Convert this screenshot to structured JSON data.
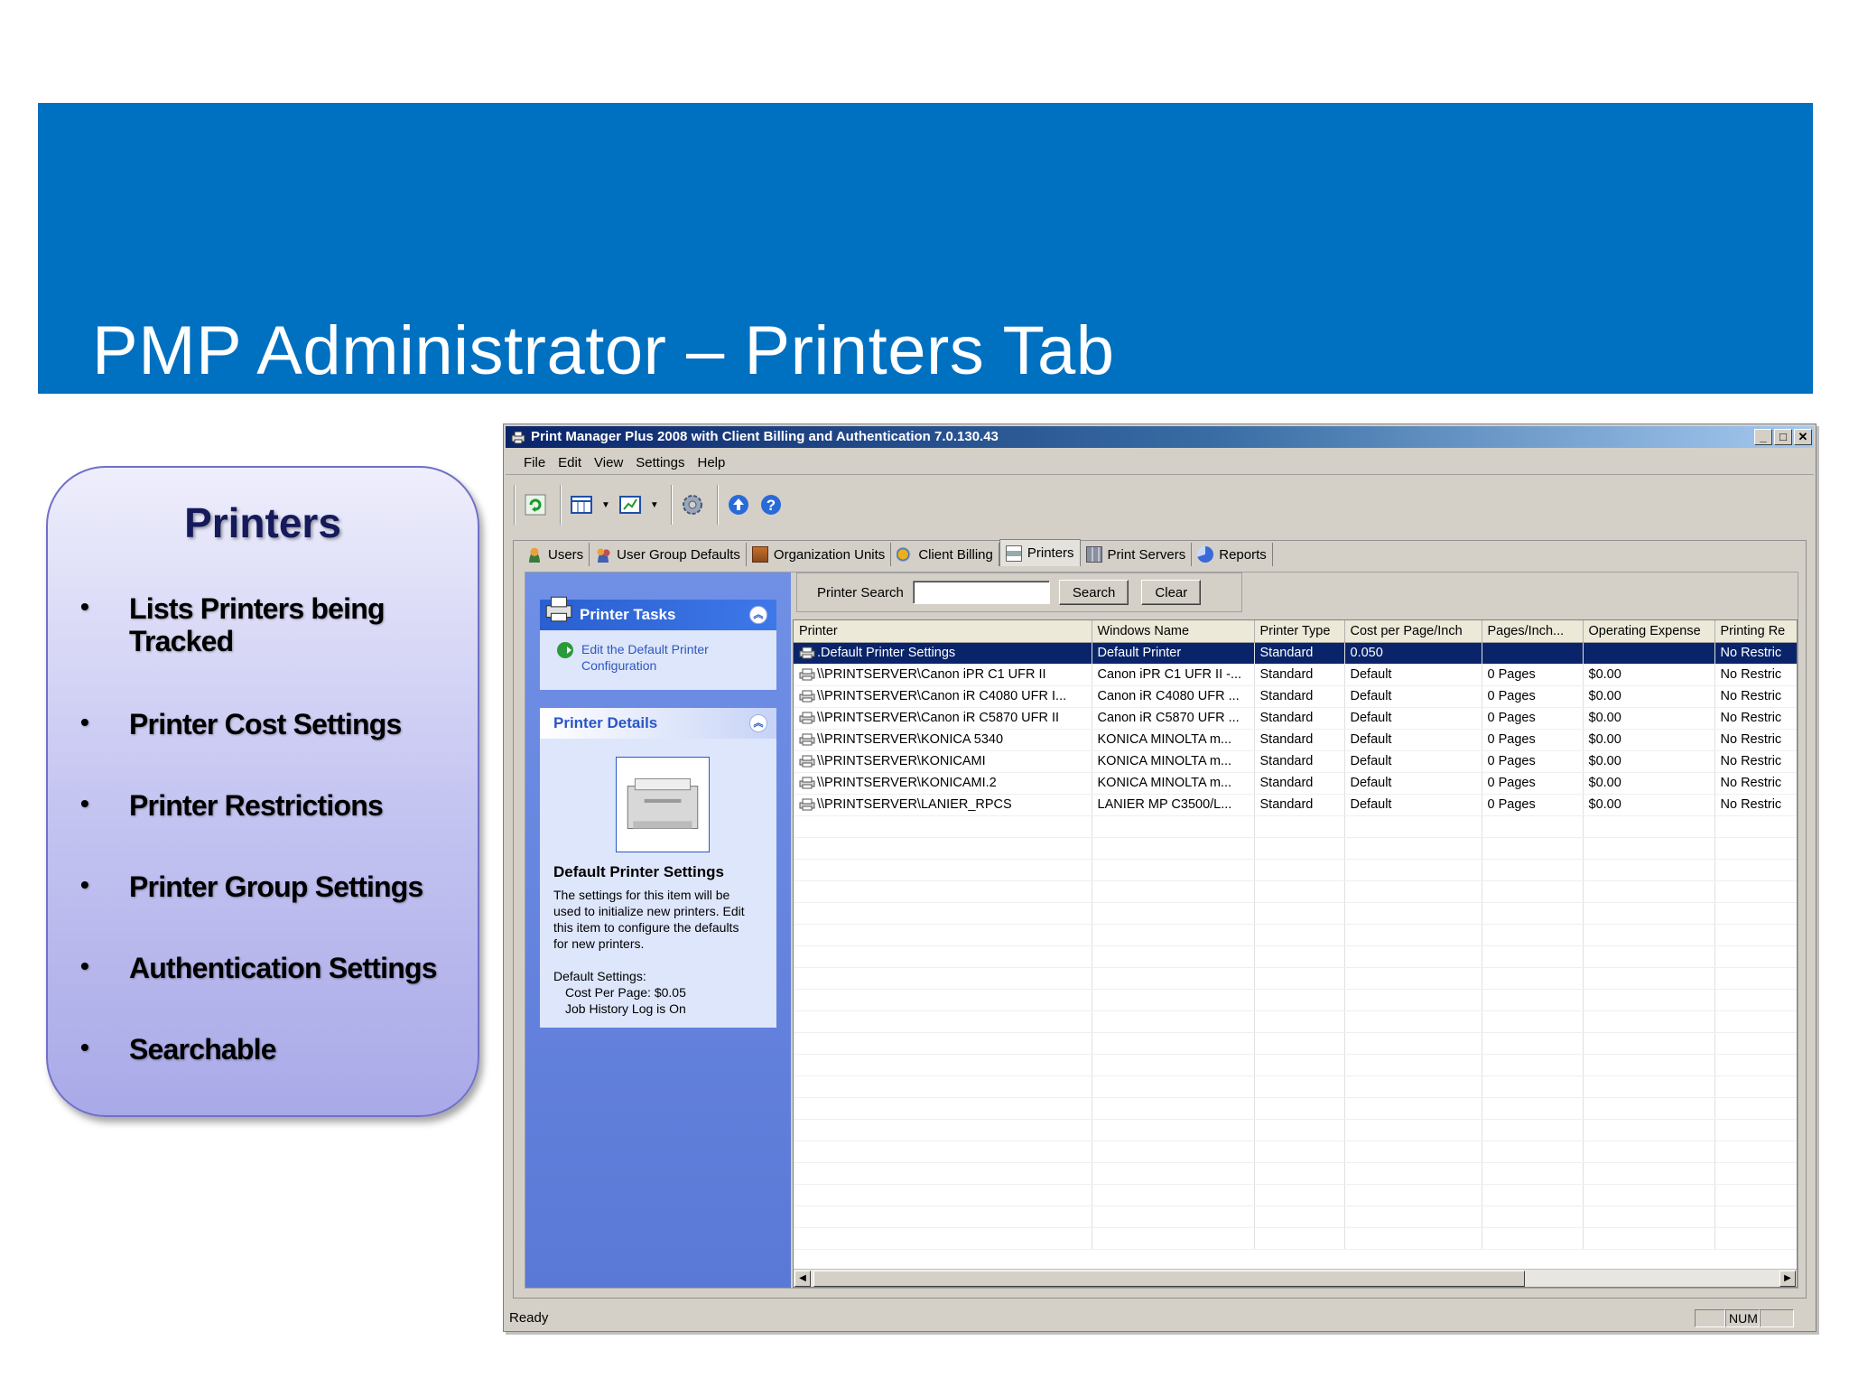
{
  "slide": {
    "title": "PMP Administrator – Printers Tab"
  },
  "callout": {
    "heading": "Printers",
    "items": [
      "Lists Printers being Tracked",
      "Printer Cost Settings",
      "Printer Restrictions",
      "Printer Group Settings",
      "Authentication Settings",
      "Searchable"
    ]
  },
  "window": {
    "title": "Print Manager Plus 2008 with Client Billing and Authentication 7.0.130.43",
    "menu": [
      "File",
      "Edit",
      "View",
      "Settings",
      "Help"
    ],
    "controls": {
      "minimize": "_",
      "maximize": "□",
      "close": "✕"
    }
  },
  "tabs": [
    "Users",
    "User Group Defaults",
    "Organization Units",
    "Client Billing",
    "Printers",
    "Print Servers",
    "Reports"
  ],
  "active_tab": "Printers",
  "tasks": {
    "title": "Printer Tasks",
    "link_line1": "Edit the Default Printer",
    "link_line2": "Configuration"
  },
  "details": {
    "title": "Printer Details",
    "name": "Default Printer Settings",
    "desc": [
      "The settings for this item will be",
      "used to initialize new printers.  Edit",
      "this item to configure the defaults",
      "for new printers."
    ],
    "defaults_label": "Default Settings:",
    "defaults": [
      "Cost Per Page: $0.05",
      "Job History Log is On"
    ]
  },
  "search": {
    "label": "Printer Search",
    "value": "",
    "search_button": "Search",
    "clear_button": "Clear"
  },
  "grid": {
    "columns": [
      "Printer",
      "Windows Name",
      "Printer Type",
      "Cost per Page/Inch",
      "Pages/Inch...",
      "Operating Expense",
      "Printing Re"
    ],
    "rows": [
      [
        ".Default Printer Settings",
        "Default Printer",
        "Standard",
        "0.050",
        "",
        "",
        "No Restric"
      ],
      [
        "\\\\PRINTSERVER\\Canon iPR C1 UFR II",
        "Canon iPR C1 UFR II -...",
        "Standard",
        "Default",
        "0 Pages",
        "$0.00",
        "No Restric"
      ],
      [
        "\\\\PRINTSERVER\\Canon iR C4080 UFR I...",
        "Canon iR C4080 UFR ...",
        "Standard",
        "Default",
        "0 Pages",
        "$0.00",
        "No Restric"
      ],
      [
        "\\\\PRINTSERVER\\Canon iR C5870 UFR II",
        "Canon iR C5870 UFR ...",
        "Standard",
        "Default",
        "0 Pages",
        "$0.00",
        "No Restric"
      ],
      [
        "\\\\PRINTSERVER\\KONICA 5340",
        "KONICA MINOLTA m...",
        "Standard",
        "Default",
        "0 Pages",
        "$0.00",
        "No Restric"
      ],
      [
        "\\\\PRINTSERVER\\KONICAMI",
        "KONICA MINOLTA m...",
        "Standard",
        "Default",
        "0 Pages",
        "$0.00",
        "No Restric"
      ],
      [
        "\\\\PRINTSERVER\\KONICAMI.2",
        "KONICA MINOLTA m...",
        "Standard",
        "Default",
        "0 Pages",
        "$0.00",
        "No Restric"
      ],
      [
        "\\\\PRINTSERVER\\LANIER_RPCS",
        "LANIER MP C3500/L...",
        "Standard",
        "Default",
        "0 Pages",
        "$0.00",
        "No Restric"
      ]
    ],
    "empty_rows": 20
  },
  "status": {
    "text": "Ready",
    "num": "NUM"
  },
  "colors": {
    "banner": "#0070c0",
    "selection": "#0a246a",
    "taskpanel": "#5a78d6"
  }
}
